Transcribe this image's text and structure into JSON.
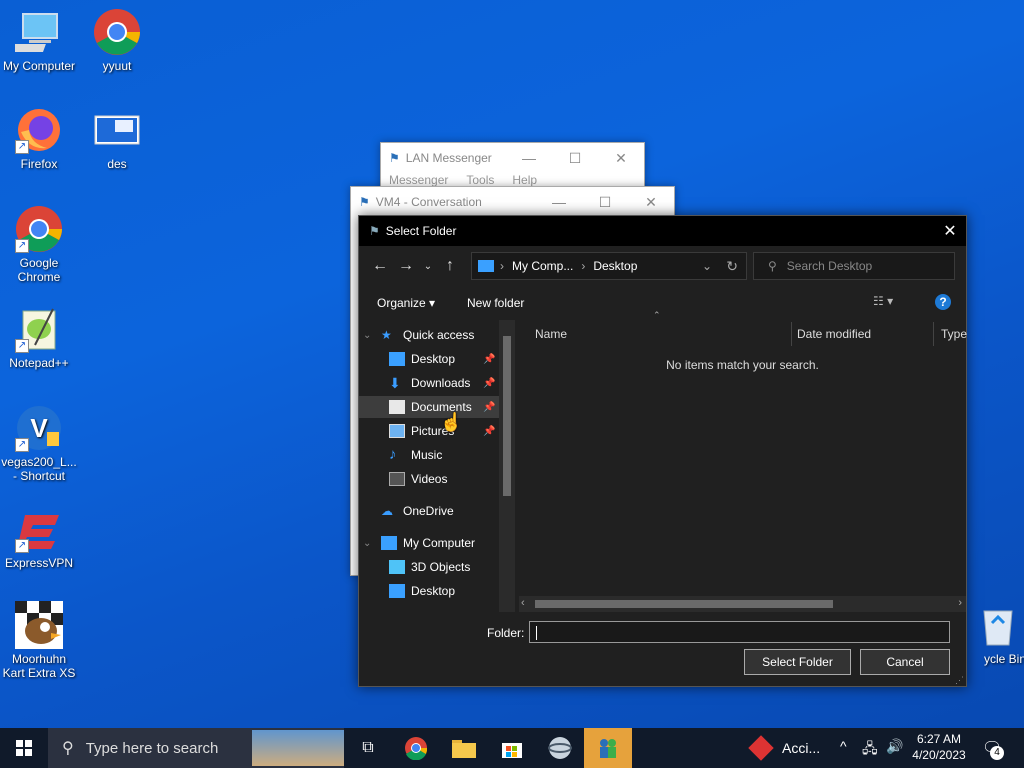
{
  "desktop": {
    "icons": [
      {
        "label": "My Computer"
      },
      {
        "label": "yyuut"
      },
      {
        "label": "Firefox"
      },
      {
        "label": "des"
      },
      {
        "label": "Google Chrome"
      },
      {
        "label": "Notepad++"
      },
      {
        "label": "vegas200_L... - Shortcut"
      },
      {
        "label": "ExpressVPN"
      },
      {
        "label": "Moorhuhn Kart Extra XS"
      },
      {
        "label": "ycle Bin"
      }
    ]
  },
  "lan_window": {
    "title": "LAN Messenger",
    "menu": [
      "Messenger",
      "Tools",
      "Help"
    ]
  },
  "conv_window": {
    "title": "VM4 - Conversation"
  },
  "dialog": {
    "title": "Select Folder",
    "breadcrumb": [
      "My Comp...",
      "Desktop"
    ],
    "search_placeholder": "Search Desktop",
    "organize": "Organize",
    "new_folder": "New folder",
    "tree": {
      "quick_access": "Quick access",
      "items": [
        "Desktop",
        "Downloads",
        "Documents",
        "Pictures",
        "Music",
        "Videos"
      ],
      "onedrive": "OneDrive",
      "my_computer": "My Computer",
      "pc_items": [
        "3D Objects",
        "Desktop"
      ]
    },
    "columns": [
      "Name",
      "Date modified",
      "Type"
    ],
    "empty_message": "No items match your search.",
    "folder_label": "Folder:",
    "folder_value": "",
    "select_button": "Select Folder",
    "cancel_button": "Cancel"
  },
  "taskbar": {
    "search_placeholder": "Type here to search",
    "tray_app": "Acci...",
    "time": "6:27 AM",
    "date": "4/20/2023",
    "notifications": "4"
  },
  "colors": {
    "desktop": "#0b5bd0",
    "dialog_bg": "#202020",
    "taskbar": "#101a2a",
    "active_taskbar": "#e6a23c"
  }
}
